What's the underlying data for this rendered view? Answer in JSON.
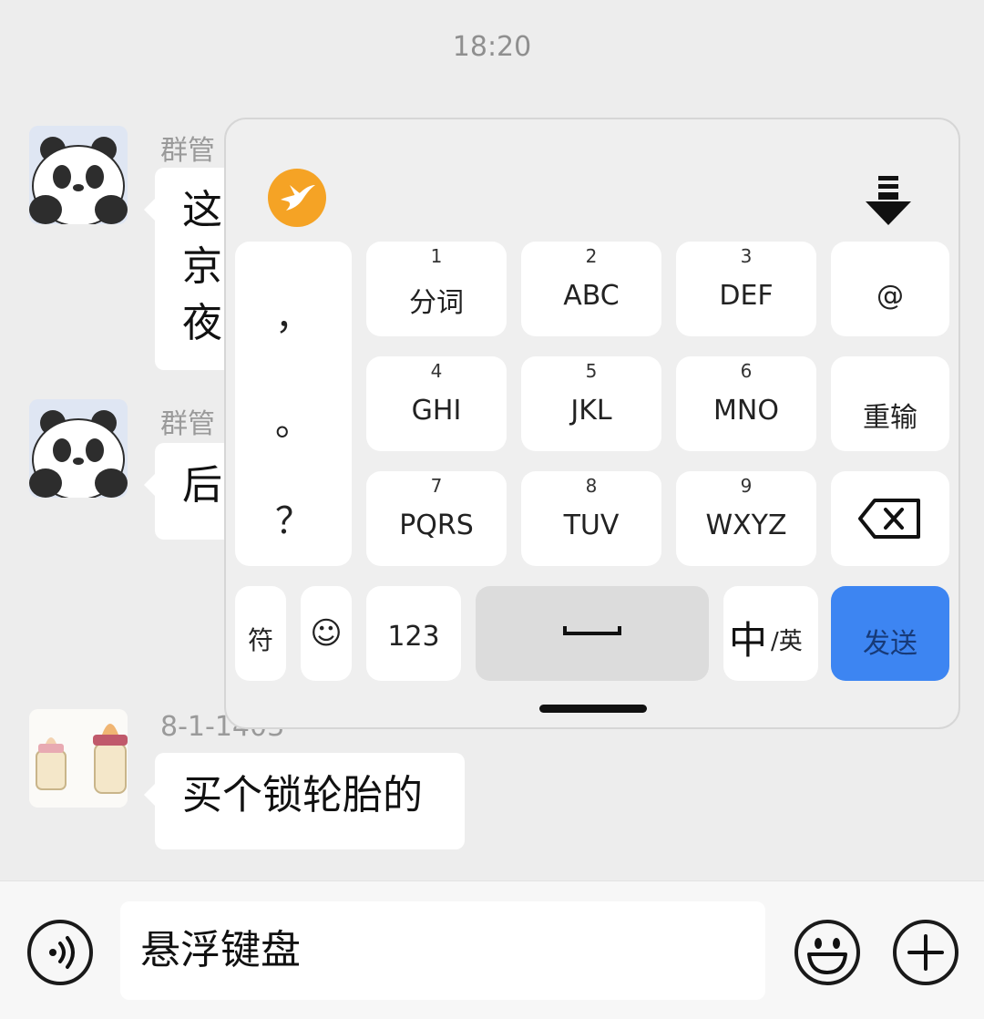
{
  "chat": {
    "timestamp": "18:20",
    "messages": [
      {
        "sender": "群管",
        "lines": [
          "这",
          "京",
          "夜"
        ]
      },
      {
        "sender": "群管",
        "lines": [
          "后"
        ]
      },
      {
        "sender": "8-1-1403",
        "lines": [
          "买个锁轮胎的"
        ]
      }
    ]
  },
  "keyboard": {
    "punctuation": [
      "，",
      "。",
      "？"
    ],
    "keys": [
      {
        "num": "1",
        "label": "分词"
      },
      {
        "num": "2",
        "label": "ABC"
      },
      {
        "num": "3",
        "label": "DEF"
      },
      {
        "num": "",
        "label": "@"
      },
      {
        "num": "4",
        "label": "GHI"
      },
      {
        "num": "5",
        "label": "JKL"
      },
      {
        "num": "6",
        "label": "MNO"
      },
      {
        "num": "",
        "label": "重输"
      },
      {
        "num": "7",
        "label": "PQRS"
      },
      {
        "num": "8",
        "label": "TUV"
      },
      {
        "num": "9",
        "label": "WXYZ"
      }
    ],
    "bottom": {
      "symbol": "符",
      "emoji": "☺",
      "numbers": "123",
      "lang_main": "中",
      "lang_sub": "/英",
      "send": "发送"
    },
    "colors": {
      "logo": "#f5a325",
      "send": "#3d85f2",
      "space": "#dcdcdc"
    }
  },
  "input": {
    "value": "悬浮键盘"
  }
}
